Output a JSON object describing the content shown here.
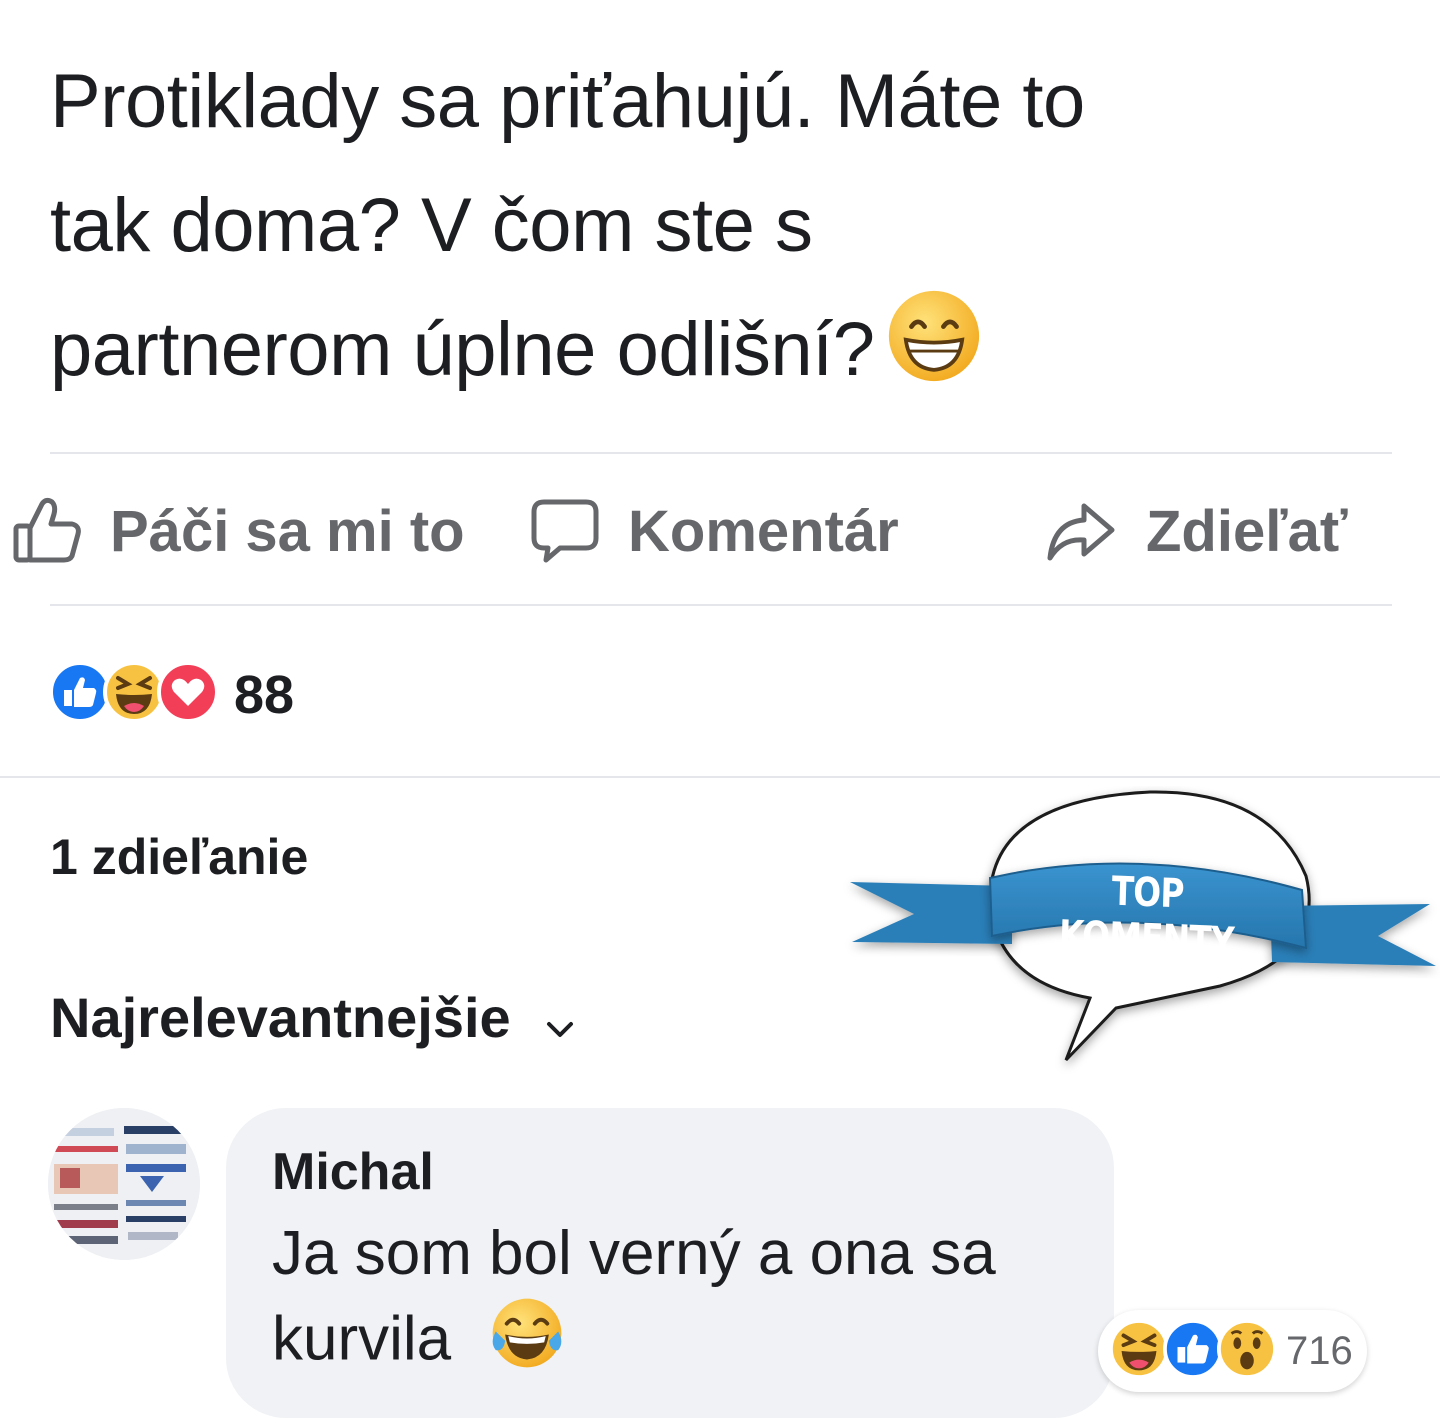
{
  "post": {
    "text_lines": [
      "Protiklady sa priťahujú. Máte to",
      "tak doma? V čom ste s",
      "partnerom úplne odlišní?"
    ],
    "emoji": "grinning-face-with-smiling-eyes"
  },
  "actions": {
    "like_label": "Páči sa mi to",
    "comment_label": "Komentár",
    "share_label": "Zdieľať"
  },
  "reactions": {
    "icons": [
      "like",
      "haha",
      "love"
    ],
    "count": "88"
  },
  "shares_text": "1 zdieľanie",
  "sort": {
    "label": "Najrelevantnejšie"
  },
  "badge": {
    "label": "TOP KOMENTY"
  },
  "comment": {
    "author": "Michal",
    "text_lines": [
      "Ja som bol verný a ona sa",
      "kurvila"
    ],
    "emoji": "face-with-tears-of-joy",
    "reactions": {
      "icons": [
        "haha",
        "like",
        "wow"
      ],
      "count": "716"
    }
  },
  "colors": {
    "like_blue": "#1877f2",
    "love_red": "#f33e58",
    "emoji_yellow": "#f7c241",
    "badge_blue": "#2f86c2",
    "muted_text": "#65676b",
    "bubble_bg": "#f0f2f5"
  }
}
